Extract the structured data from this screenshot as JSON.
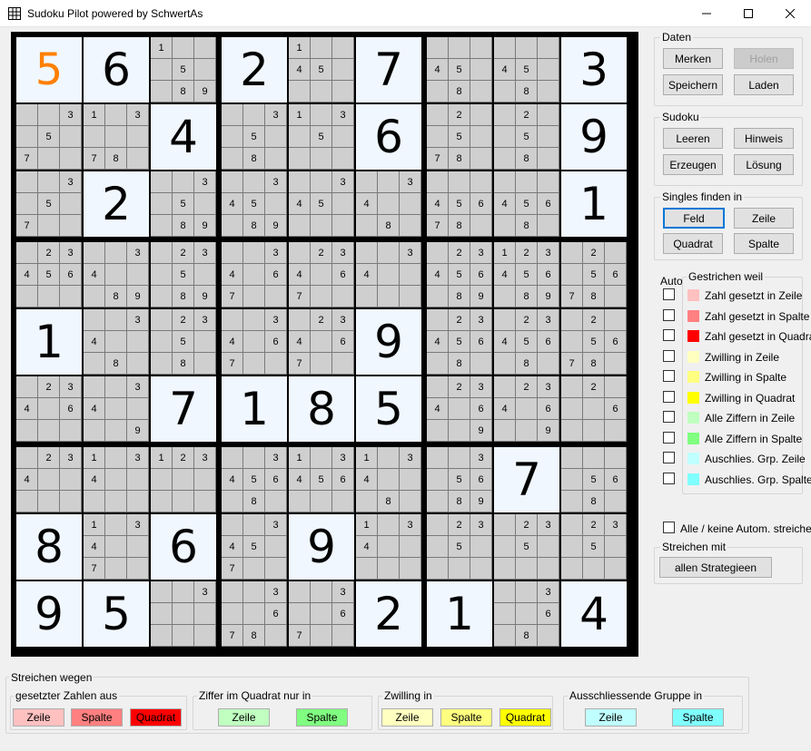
{
  "window": {
    "title": "Sudoku Pilot powered by SchwertAs",
    "min": "—",
    "max": "☐",
    "close": "✕"
  },
  "board": {
    "rows": [
      [
        {
          "v": "5",
          "o": 1
        },
        {
          "v": "6"
        },
        {
          "c": [
            1,
            5,
            8,
            9
          ]
        },
        {
          "v": "2"
        },
        {
          "c": [
            1,
            4,
            5
          ]
        },
        {
          "v": "7"
        },
        {
          "c": [
            4,
            5,
            8
          ]
        },
        {
          "c": [
            4,
            5,
            8
          ]
        },
        {
          "v": "3"
        }
      ],
      [
        {
          "c": [
            3,
            5,
            7
          ]
        },
        {
          "c": [
            1,
            3,
            7,
            8
          ]
        },
        {
          "v": "4"
        },
        {
          "c": [
            3,
            5,
            8
          ]
        },
        {
          "c": [
            1,
            3,
            5
          ]
        },
        {
          "v": "6"
        },
        {
          "c": [
            2,
            5,
            7,
            8
          ]
        },
        {
          "c": [
            2,
            5,
            8
          ]
        },
        {
          "v": "9"
        }
      ],
      [
        {
          "c": [
            3,
            5,
            7
          ]
        },
        {
          "v": "2"
        },
        {
          "c": [
            3,
            5,
            8,
            9
          ]
        },
        {
          "c": [
            3,
            4,
            5,
            8,
            9
          ]
        },
        {
          "c": [
            3,
            4,
            5
          ]
        },
        {
          "c": [
            3,
            4,
            8
          ]
        },
        {
          "c": [
            4,
            5,
            6,
            7,
            8
          ]
        },
        {
          "c": [
            4,
            5,
            6,
            8
          ]
        },
        {
          "v": "1"
        }
      ],
      [
        {
          "c": [
            2,
            3,
            4,
            5,
            6
          ]
        },
        {
          "c": [
            3,
            4,
            8,
            9
          ]
        },
        {
          "c": [
            2,
            3,
            5,
            8,
            9
          ]
        },
        {
          "c": [
            3,
            4,
            6,
            7
          ]
        },
        {
          "c": [
            2,
            3,
            4,
            6,
            7
          ]
        },
        {
          "c": [
            3,
            4
          ]
        },
        {
          "c": [
            2,
            3,
            4,
            5,
            6,
            8,
            9
          ]
        },
        {
          "c": [
            1,
            2,
            3,
            4,
            5,
            6,
            8,
            9
          ]
        },
        {
          "c": [
            2,
            5,
            6,
            7,
            8
          ]
        }
      ],
      [
        {
          "v": "1"
        },
        {
          "c": [
            3,
            4,
            8
          ]
        },
        {
          "c": [
            2,
            3,
            5,
            8
          ]
        },
        {
          "c": [
            3,
            4,
            6,
            7
          ]
        },
        {
          "c": [
            2,
            3,
            4,
            6,
            7
          ]
        },
        {
          "v": "9"
        },
        {
          "c": [
            2,
            3,
            4,
            5,
            6,
            8
          ]
        },
        {
          "c": [
            2,
            3,
            4,
            5,
            6,
            8
          ]
        },
        {
          "c": [
            2,
            5,
            6,
            7,
            8
          ]
        }
      ],
      [
        {
          "c": [
            2,
            3,
            4,
            6
          ]
        },
        {
          "c": [
            3,
            4,
            9
          ]
        },
        {
          "v": "7"
        },
        {
          "v": "1"
        },
        {
          "v": "8"
        },
        {
          "v": "5"
        },
        {
          "c": [
            2,
            3,
            4,
            6,
            9
          ]
        },
        {
          "c": [
            2,
            3,
            4,
            6,
            9
          ]
        },
        {
          "c": [
            2,
            6
          ]
        }
      ],
      [
        {
          "c": [
            2,
            3,
            4
          ]
        },
        {
          "c": [
            1,
            3,
            4
          ]
        },
        {
          "c": [
            1,
            2,
            3
          ]
        },
        {
          "c": [
            3,
            4,
            5,
            6,
            8
          ]
        },
        {
          "c": [
            1,
            3,
            4,
            5,
            6
          ]
        },
        {
          "c": [
            1,
            3,
            4,
            8
          ]
        },
        {
          "c": [
            3,
            5,
            6,
            8,
            9
          ]
        },
        {
          "v": "7"
        },
        {
          "c": [
            5,
            6,
            8
          ]
        }
      ],
      [
        {
          "v": "8"
        },
        {
          "c": [
            1,
            3,
            4,
            7
          ]
        },
        {
          "v": "6"
        },
        {
          "c": [
            3,
            4,
            5,
            7
          ]
        },
        {
          "v": "9"
        },
        {
          "c": [
            1,
            3,
            4
          ]
        },
        {
          "c": [
            2,
            3,
            5
          ]
        },
        {
          "c": [
            2,
            3,
            5
          ]
        },
        {
          "c": [
            2,
            3,
            5
          ]
        }
      ],
      [
        {
          "v": "9"
        },
        {
          "v": "5"
        },
        {
          "c": [
            3
          ]
        },
        {
          "c": [
            3,
            6,
            7,
            8
          ]
        },
        {
          "c": [
            3,
            6,
            7
          ]
        },
        {
          "v": "2"
        },
        {
          "v": "1"
        },
        {
          "c": [
            3,
            6,
            8
          ]
        },
        {
          "v": "4"
        }
      ]
    ]
  },
  "daten": {
    "label": "Daten",
    "merken": "Merken",
    "holen": "Holen",
    "speichern": "Speichern",
    "laden": "Laden"
  },
  "sudoku": {
    "label": "Sudoku",
    "leeren": "Leeren",
    "hinweis": "Hinweis",
    "erzeugen": "Erzeugen",
    "loesung": "Lösung"
  },
  "singles": {
    "label": "Singles finden in",
    "feld": "Feld",
    "zeile": "Zeile",
    "quadrat": "Quadrat",
    "spalte": "Spalte"
  },
  "auto": {
    "label": "Auto"
  },
  "gestrichen": {
    "label": "Gestrichen weil",
    "items": [
      {
        "text": "Zahl gesetzt in Zeile",
        "color": "#ffc0c0"
      },
      {
        "text": "Zahl gesetzt in Spalte",
        "color": "#ff8080"
      },
      {
        "text": "Zahl gesetzt in Quadrat",
        "color": "#ff0000"
      },
      {
        "text": "Zwilling in Zeile",
        "color": "#ffffc0"
      },
      {
        "text": "Zwilling in Spalte",
        "color": "#ffff80"
      },
      {
        "text": "Zwilling in Quadrat",
        "color": "#ffff00"
      },
      {
        "text": "Alle Ziffern in Zeile",
        "color": "#c0ffc0"
      },
      {
        "text": "Alle Ziffern in Spalte",
        "color": "#80ff80"
      },
      {
        "text": "Auschlies. Grp. Zeile",
        "color": "#c0ffff"
      },
      {
        "text": "Auschlies. Grp. Spalte",
        "color": "#80ffff"
      }
    ]
  },
  "alle_keine": "Alle / keine Autom. streichen",
  "streichen_mit": {
    "label": "Streichen mit",
    "button": "allen Strategieen"
  },
  "bottom": {
    "label": "Streichen wegen",
    "gesetzt": {
      "label": "gesetzter Zahlen aus",
      "zeile": "Zeile",
      "spalte": "Spalte",
      "quadrat": "Quadrat"
    },
    "ziffer": {
      "label": "Ziffer im Quadrat nur in",
      "zeile": "Zeile",
      "spalte": "Spalte"
    },
    "zwilling": {
      "label": "Zwilling in",
      "zeile": "Zeile",
      "spalte": "Spalte",
      "quadrat": "Quadrat"
    },
    "auschl": {
      "label": "Ausschliessende Gruppe in",
      "zeile": "Zeile",
      "spalte": "Spalte"
    }
  }
}
